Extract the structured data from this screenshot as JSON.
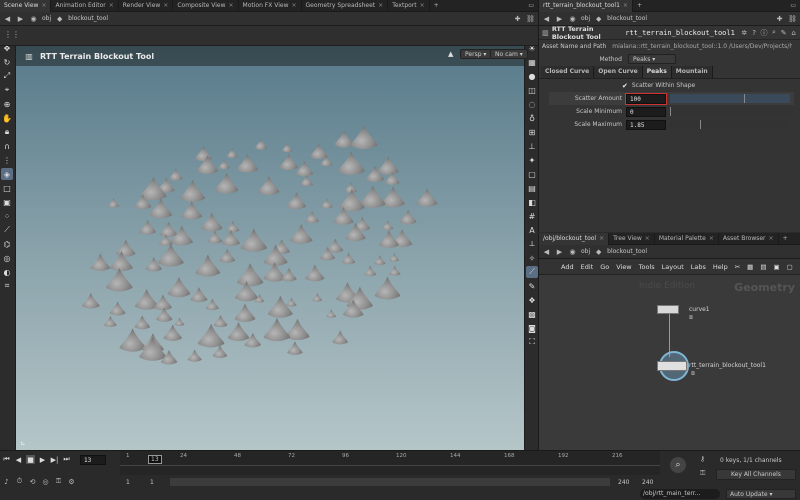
{
  "viewer": {
    "tabs": [
      {
        "label": "Scene View"
      },
      {
        "label": "Animation Editor"
      },
      {
        "label": "Render View"
      },
      {
        "label": "Composite View"
      },
      {
        "label": "Motion FX View"
      },
      {
        "label": "Geometry Spreadsheet"
      },
      {
        "label": "Textport"
      }
    ],
    "path_obj": "obj",
    "path_node": "blockout_tool",
    "hud_title": "RTT Terrain Blockout Tool",
    "camera_menu": "Persp",
    "cam_menu": "No cam"
  },
  "params": {
    "tab_label": "rtt_terrain_blockout_tool1",
    "path_obj": "obj",
    "path_node": "blockout_tool",
    "header_type": "RTT Terrain Blockout Tool",
    "header_name": "rtt_terrain_blockout_tool1",
    "asset_label": "Asset Name and Path",
    "asset_value": "mialana::rtt_terrain_blockout_tool::1.0 /Users/Dev/Projects/houdi...",
    "method_label": "Method",
    "method_value": "Peaks",
    "folders": [
      {
        "label": "Closed Curve"
      },
      {
        "label": "Open Curve"
      },
      {
        "label": "Peaks"
      },
      {
        "label": "Mountain"
      }
    ],
    "scatter_within_shape": "Scatter Within Shape",
    "scatter_amount_label": "Scatter Amount",
    "scatter_amount_value": "100",
    "scatter_amount_fill": 0.62,
    "scale_min_label": "Scale Minimum",
    "scale_min_value": "0",
    "scale_max_label": "Scale Maximum",
    "scale_max_value": "1.85",
    "scale_max_fill": 0.25
  },
  "network": {
    "tabs": [
      {
        "label": "/obj/blockout_tool"
      },
      {
        "label": "Tree View"
      },
      {
        "label": "Material Palette"
      },
      {
        "label": "Asset Browser"
      }
    ],
    "path_obj": "obj",
    "path_node": "blockout_tool",
    "menu": [
      "Add",
      "Edit",
      "Go",
      "View",
      "Tools",
      "Layout",
      "Labs",
      "Help"
    ],
    "watermark": "Indie Edition",
    "context_label": "Geometry",
    "node1": "curve1",
    "node2": "rtt_terrain_blockout_tool1"
  },
  "timeline": {
    "current_frame": "13",
    "ticks": [
      "1",
      "24",
      "48",
      "72",
      "96",
      "120",
      "144",
      "168",
      "192",
      "216"
    ],
    "marker_frame": "13",
    "start_a": "1",
    "start_b": "1",
    "end_a": "240",
    "end_b": "240",
    "keys_info": "0 keys, 1/1 channels",
    "key_all": "Key All Channels",
    "path": "/obj/rtt_main_terr...",
    "auto_update": "Auto Update"
  }
}
